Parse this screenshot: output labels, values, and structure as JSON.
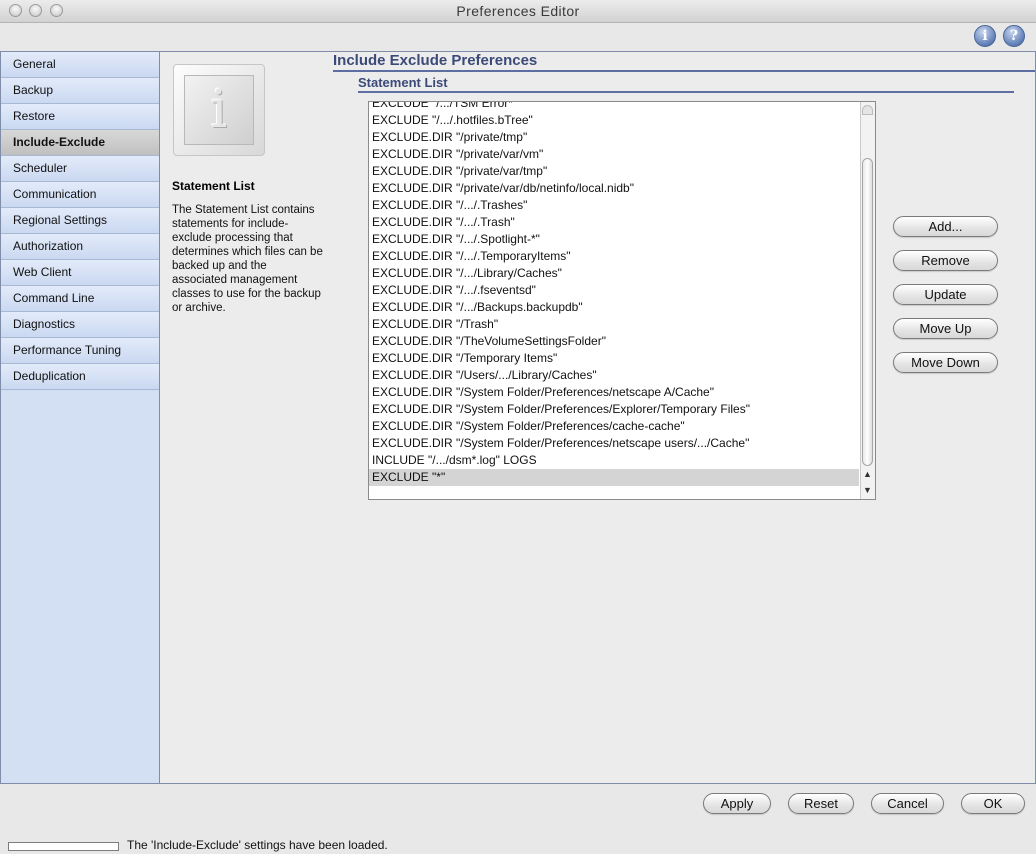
{
  "window": {
    "title": "Preferences Editor"
  },
  "help": {
    "info_icon": "info-icon",
    "help_icon": "help-icon",
    "info_glyph": "i",
    "help_glyph": "?"
  },
  "sidebar": {
    "items": [
      {
        "label": "General",
        "active": false
      },
      {
        "label": "Backup",
        "active": false
      },
      {
        "label": "Restore",
        "active": false
      },
      {
        "label": "Include-Exclude",
        "active": true
      },
      {
        "label": "Scheduler",
        "active": false
      },
      {
        "label": "Communication",
        "active": false
      },
      {
        "label": "Regional Settings",
        "active": false
      },
      {
        "label": "Authorization",
        "active": false
      },
      {
        "label": "Web Client",
        "active": false
      },
      {
        "label": "Command Line",
        "active": false
      },
      {
        "label": "Diagnostics",
        "active": false
      },
      {
        "label": "Performance Tuning",
        "active": false
      },
      {
        "label": "Deduplication",
        "active": false
      }
    ]
  },
  "info_panel": {
    "heading": "Statement List",
    "description": "The Statement List contains statements for include-exclude processing that determines which files can be backed up and the associated management classes to use for the backup or archive."
  },
  "main": {
    "title": "Include Exclude Preferences",
    "section_title": "Statement List",
    "statements": [
      "EXCLUDE \"/.../TSM Error*\"",
      "EXCLUDE \"/.../.hotfiles.bTree\"",
      "EXCLUDE.DIR \"/private/tmp\"",
      "EXCLUDE.DIR \"/private/var/vm\"",
      "EXCLUDE.DIR \"/private/var/tmp\"",
      "EXCLUDE.DIR \"/private/var/db/netinfo/local.nidb\"",
      "EXCLUDE.DIR \"/.../.Trashes\"",
      "EXCLUDE.DIR \"/.../.Trash\"",
      "EXCLUDE.DIR \"/.../.Spotlight-*\"",
      "EXCLUDE.DIR \"/.../.TemporaryItems\"",
      "EXCLUDE.DIR \"/.../Library/Caches\"",
      "EXCLUDE.DIR \"/.../.fseventsd\"",
      "EXCLUDE.DIR \"/.../Backups.backupdb\"",
      "EXCLUDE.DIR \"/Trash\"",
      "EXCLUDE.DIR \"/TheVolumeSettingsFolder\"",
      "EXCLUDE.DIR \"/Temporary Items\"",
      "EXCLUDE.DIR \"/Users/.../Library/Caches\"",
      "EXCLUDE.DIR \"/System Folder/Preferences/netscape A/Cache\"",
      "EXCLUDE.DIR \"/System Folder/Preferences/Explorer/Temporary Files\"",
      "EXCLUDE.DIR \"/System Folder/Preferences/cache-cache\"",
      "EXCLUDE.DIR \"/System Folder/Preferences/netscape users/.../Cache\"",
      "INCLUDE \"/.../dsm*.log\" LOGS",
      "EXCLUDE \"*\""
    ],
    "selected_index": 22,
    "actions": {
      "add": "Add...",
      "remove": "Remove",
      "update": "Update",
      "move_up": "Move Up",
      "move_down": "Move Down"
    }
  },
  "footer": {
    "apply": "Apply",
    "reset": "Reset",
    "cancel": "Cancel",
    "ok": "OK",
    "status": "The 'Include-Exclude' settings have been loaded."
  }
}
